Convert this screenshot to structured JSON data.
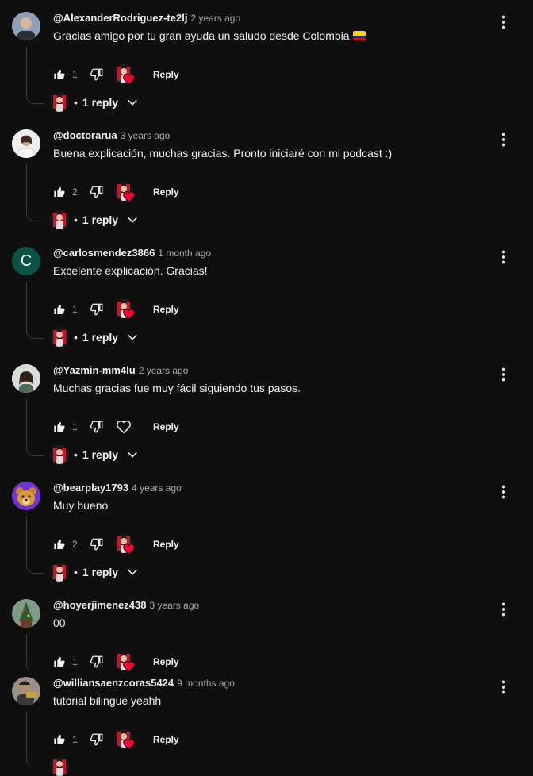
{
  "comments": [
    {
      "author": "@AlexanderRodriguez-te2lj",
      "time": "2 years ago",
      "text": "Gracias amigo por tu gran ayuda un saludo desde Colombia",
      "flag_icon": "colombia-flag-emoji",
      "likes": "1",
      "reply_label": "Reply",
      "replies_label": "1 reply",
      "creator_hearted": true,
      "avatar": "photo"
    },
    {
      "author": "@doctorarua",
      "time": "3 years ago",
      "text": "Buena explicación, muchas gracias. Pronto iniciaré con mi podcast :)",
      "likes": "2",
      "reply_label": "Reply",
      "replies_label": "1 reply",
      "creator_hearted": true,
      "avatar": "photo"
    },
    {
      "author": "@carlosmendez3866",
      "time": "1 month ago",
      "text": "Excelente explicación. Gracias!",
      "likes": "1",
      "reply_label": "Reply",
      "replies_label": "1 reply",
      "creator_hearted": true,
      "avatar_letter": "C",
      "avatar_color": "#0b5345"
    },
    {
      "author": "@Yazmin-mm4lu",
      "time": "2 years ago",
      "text": "Muchas gracias fue muy fácil siguiendo tus pasos.",
      "likes": "1",
      "reply_label": "Reply",
      "replies_label": "1 reply",
      "creator_hearted": false,
      "avatar": "photo"
    },
    {
      "author": "@bearplay1793",
      "time": "4 years ago",
      "text": "Muy bueno",
      "likes": "2",
      "reply_label": "Reply",
      "replies_label": "1 reply",
      "creator_hearted": true,
      "avatar": "bear"
    },
    {
      "author": "@hoyerjimenez438",
      "time": "3 years ago",
      "text": "00",
      "likes": "1",
      "reply_label": "Reply",
      "creator_hearted": true,
      "avatar": "photo"
    },
    {
      "author": "@williansaenzcoras5424",
      "time": "9 months ago",
      "text": "tutorial bilingue yeahh",
      "likes": "1",
      "reply_label": "Reply",
      "creator_hearted": true,
      "avatar": "photo"
    }
  ],
  "icons": {
    "like": "thumbs-up-icon",
    "dislike": "thumbs-down-icon",
    "heart": "heart-outline-icon",
    "more": "more-vert-icon",
    "expand": "chevron-down-icon"
  },
  "colors": {
    "background": "#0f0f0f",
    "text": "#f1f1f1",
    "secondary": "#aaaaaa",
    "heart": "#ff0033"
  }
}
